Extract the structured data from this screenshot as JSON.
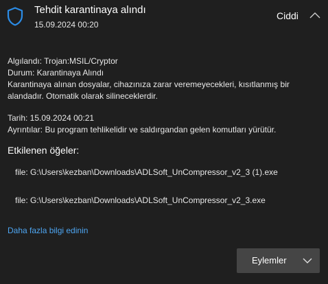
{
  "header": {
    "title": "Tehdit karantinaya alındı",
    "timestamp": "15.09.2024 00:20",
    "severity": "Ciddi",
    "icon": "shield-icon",
    "collapse_icon": "chevron-up-icon"
  },
  "details": {
    "detected": "Algılandı:  Trojan:MSIL/Cryptor",
    "status": "Durum:  Karantinaya Alındı",
    "description": "Karantinaya alınan dosyalar, cihazınıza zarar veremeyecekleri, kısıtlanmış bir alandadır. Otomatik olarak silineceklerdir.",
    "date": "Tarih:  15.09.2024 00:21",
    "info": "Ayrıntılar:  Bu program tehlikelidir ve saldırgandan gelen komutları yürütür."
  },
  "affected": {
    "heading": "Etkilenen öğeler:",
    "items": [
      "file: G:\\Users\\kezban\\Downloads\\ADLSoft_UnCompressor_v2_3 (1).exe",
      "file: G:\\Users\\kezban\\Downloads\\ADLSoft_UnCompressor_v2_3.exe"
    ]
  },
  "links": {
    "more_info": "Daha fazla bilgi edinin"
  },
  "actions": {
    "label": "Eylemler",
    "chevron_icon": "chevron-down-icon"
  },
  "colors": {
    "background": "#1f1f1f",
    "accent": "#1e7fd6",
    "link": "#4ea6f2",
    "button": "#454545"
  }
}
